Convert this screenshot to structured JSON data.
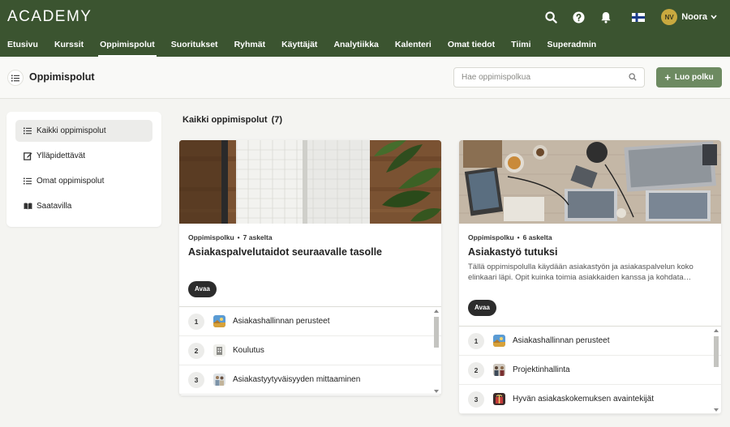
{
  "app": {
    "logo": "ACADEMY"
  },
  "user": {
    "initials": "NV",
    "name": "Noora"
  },
  "nav": [
    {
      "label": "Etusivu",
      "active": false
    },
    {
      "label": "Kurssit",
      "active": false
    },
    {
      "label": "Oppimispolut",
      "active": true
    },
    {
      "label": "Suoritukset",
      "active": false
    },
    {
      "label": "Ryhmät",
      "active": false
    },
    {
      "label": "Käyttäjät",
      "active": false
    },
    {
      "label": "Analytiikka",
      "active": false
    },
    {
      "label": "Kalenteri",
      "active": false
    },
    {
      "label": "Omat tiedot",
      "active": false
    },
    {
      "label": "Tiimi",
      "active": false
    },
    {
      "label": "Superadmin",
      "active": false
    }
  ],
  "page": {
    "title": "Oppimispolut",
    "search_placeholder": "Hae oppimispolkua",
    "create_label": "Luo polku"
  },
  "sidebar": {
    "items": [
      {
        "label": "Kaikki oppimispolut",
        "icon": "list-icon",
        "active": true
      },
      {
        "label": "Ylläpidettävät",
        "icon": "edit-icon",
        "active": false
      },
      {
        "label": "Omat oppimispolut",
        "icon": "list-icon",
        "active": false
      },
      {
        "label": "Saatavilla",
        "icon": "book-icon",
        "active": false
      }
    ]
  },
  "main": {
    "section_title": "Kaikki oppimispolut",
    "count": "(7)",
    "cards": [
      {
        "type": "Oppimispolku",
        "steps_count": "7 askelta",
        "title": "Asiakaspalvelutaidot seuraavalle tasolle",
        "description": "",
        "open_label": "Avaa",
        "steps": [
          {
            "num": "1",
            "label": "Asiakashallinnan perusteet",
            "thumb": "landscape"
          },
          {
            "num": "2",
            "label": "Koulutus",
            "thumb": "building"
          },
          {
            "num": "3",
            "label": "Asiakastyytyväisyyden mittaaminen",
            "thumb": "people"
          }
        ]
      },
      {
        "type": "Oppimispolku",
        "steps_count": "6 askelta",
        "title": "Asiakastyö tutuksi",
        "description": "Tällä oppimispolulla käydään asiakastyön ja asiakaspalvelun koko elinkaari läpi. Opit kuinka toimia asiakkaiden kanssa ja kohdata…",
        "open_label": "Avaa",
        "steps": [
          {
            "num": "1",
            "label": "Asiakashallinnan perusteet",
            "thumb": "landscape"
          },
          {
            "num": "2",
            "label": "Projektinhallinta",
            "thumb": "team"
          },
          {
            "num": "3",
            "label": "Hyvän asiakaskokemuksen avaintekijät",
            "thumb": "gift"
          }
        ]
      }
    ]
  },
  "colors": {
    "topbar": "#3b5430",
    "accent_button": "#6d8a61",
    "avatar": "#c9a93f"
  }
}
